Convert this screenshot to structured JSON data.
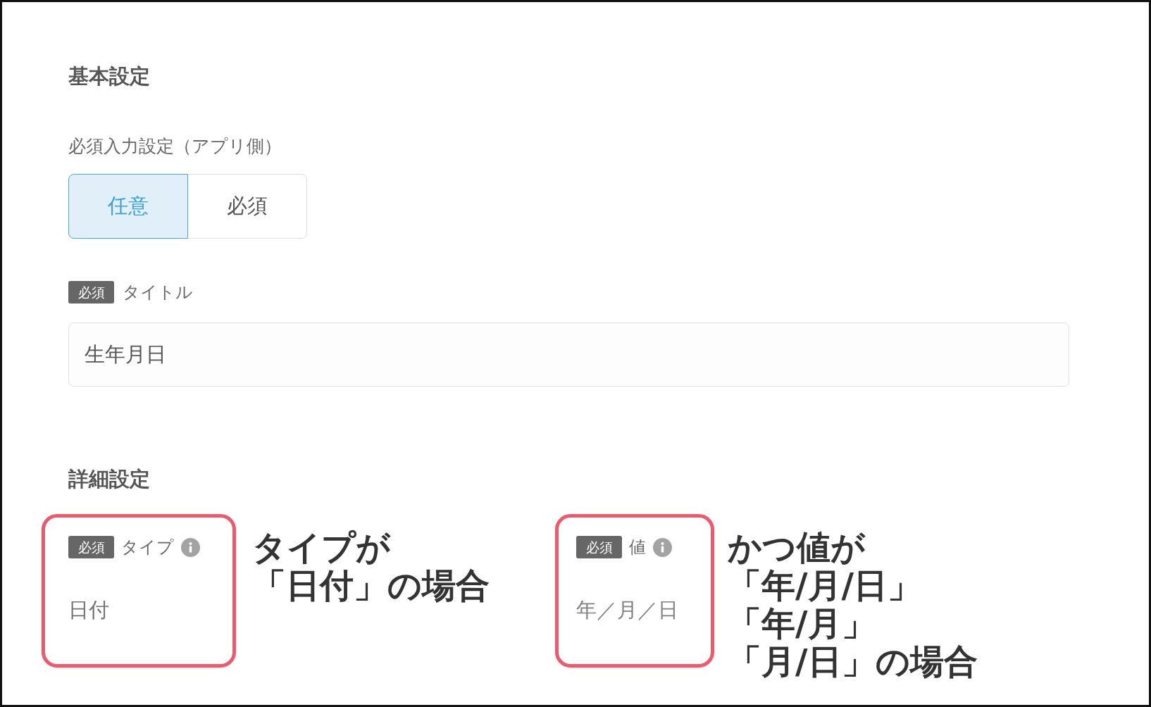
{
  "basic_settings": {
    "heading": "基本設定",
    "required_input": {
      "label": "必須入力設定（アプリ側）",
      "options": [
        {
          "label": "任意",
          "selected": true
        },
        {
          "label": "必須",
          "selected": false
        }
      ]
    },
    "title_field": {
      "badge": "必須",
      "label": "タイトル",
      "value": "生年月日"
    }
  },
  "detail_settings": {
    "heading": "詳細設定",
    "fields": [
      {
        "badge": "必須",
        "label": "タイプ",
        "value": "日付",
        "annotation": [
          "タイプが",
          "「日付」の場合"
        ]
      },
      {
        "badge": "必須",
        "label": "値",
        "value": "年／月／日",
        "annotation": [
          "かつ値が",
          "「年/月/日」",
          "「年/月」",
          "「月/日」の場合"
        ]
      }
    ]
  }
}
